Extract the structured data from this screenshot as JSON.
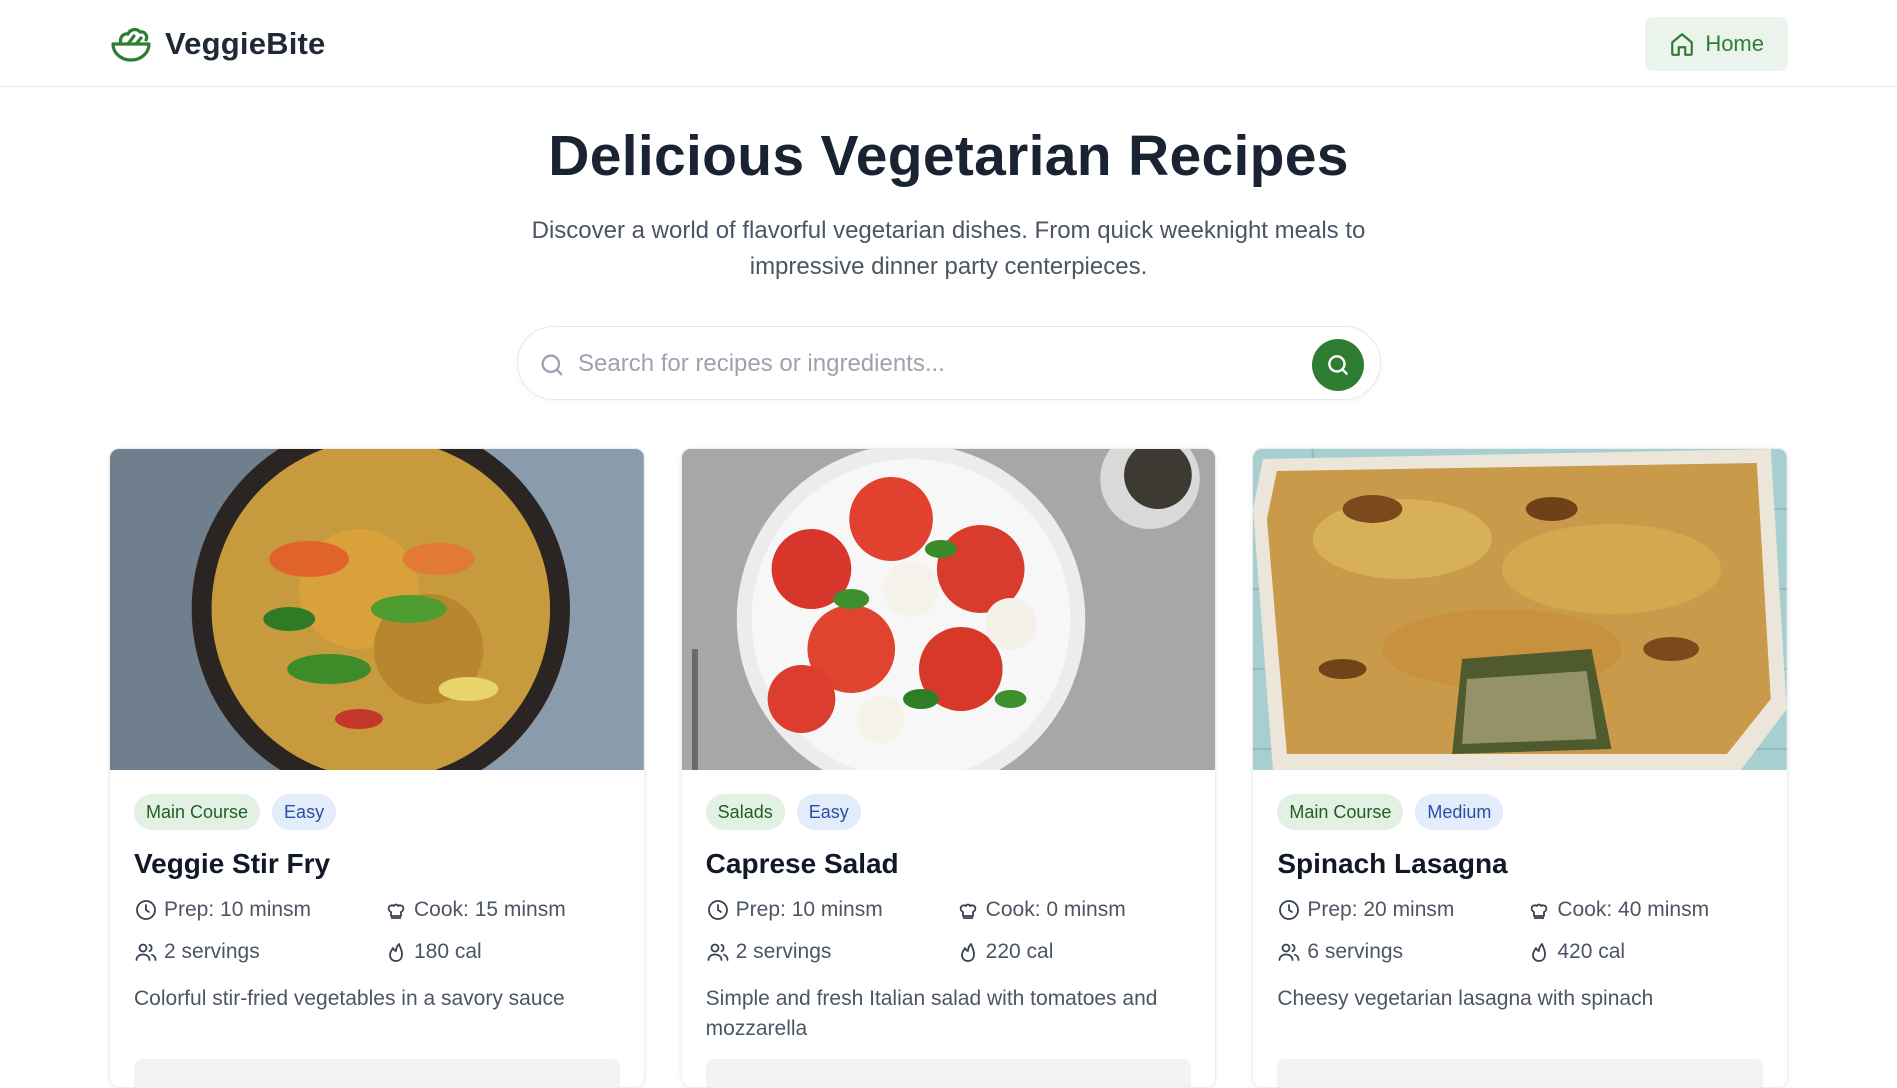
{
  "brand": {
    "name": "VeggieBite",
    "logo_icon": "salad-bowl-icon",
    "accent": "#2e7d32"
  },
  "nav": {
    "home_label": "Home",
    "home_icon": "home-icon"
  },
  "hero": {
    "title": "Delicious Vegetarian Recipes",
    "subtitle": "Discover a world of flavorful vegetarian dishes. From quick weeknight meals to impressive dinner party centerpieces."
  },
  "search": {
    "placeholder": "Search for recipes or ingredients...",
    "value": "",
    "icon": "search-icon"
  },
  "recipes": [
    {
      "category": "Main Course",
      "difficulty": "Easy",
      "title": "Veggie Stir Fry",
      "prep": "Prep: 10 minsm",
      "cook": "Cook: 15 minsm",
      "servings": "2 servings",
      "calories": "180 cal",
      "description": "Colorful stir-fried vegetables in a savory sauce"
    },
    {
      "category": "Salads",
      "difficulty": "Easy",
      "title": "Caprese Salad",
      "prep": "Prep: 10 minsm",
      "cook": "Cook: 0 minsm",
      "servings": "2 servings",
      "calories": "220 cal",
      "description": "Simple and fresh Italian salad with tomatoes and mozzarella"
    },
    {
      "category": "Main Course",
      "difficulty": "Medium",
      "title": "Spinach Lasagna",
      "prep": "Prep: 20 minsm",
      "cook": "Cook: 40 minsm",
      "servings": "6 servings",
      "calories": "420 cal",
      "description": "Cheesy vegetarian lasagna with spinach"
    }
  ]
}
